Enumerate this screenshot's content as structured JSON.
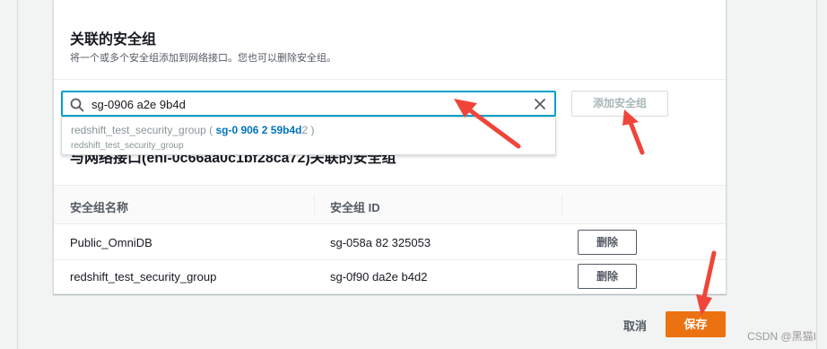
{
  "panel": {
    "title": "关联的安全组",
    "description": "将一个或多个安全组添加到网络接口。您也可以删除安全组。",
    "search_value": "sg-0906  a2e  9b4d",
    "add_button_label": "添加安全组",
    "section_title": "与网络接口(eni-0c66aa0c1bf28ca72)关联的安全组"
  },
  "dropdown": {
    "option_name": "redshift_test_security_group",
    "option_id": "sg-0  906  2  59b4d",
    "option_id_tail": "2",
    "option_sub": "redshift_test_security_group"
  },
  "table": {
    "headers": [
      "安全组名称",
      "安全组 ID"
    ],
    "rows": [
      {
        "name": "Public_OmniDB",
        "id": "sg-058a   82   325053",
        "action": "删除"
      },
      {
        "name": "redshift_test_security_group",
        "id": "sg-0f90   da2e   b4d2",
        "action": "删除"
      }
    ]
  },
  "footer": {
    "cancel_label": "取消",
    "save_label": "保存"
  },
  "watermark": "CSDN @黑猫I",
  "colors": {
    "accent": "#00a1c9",
    "primary": "#ec7211",
    "arrow": "#f0453a"
  }
}
